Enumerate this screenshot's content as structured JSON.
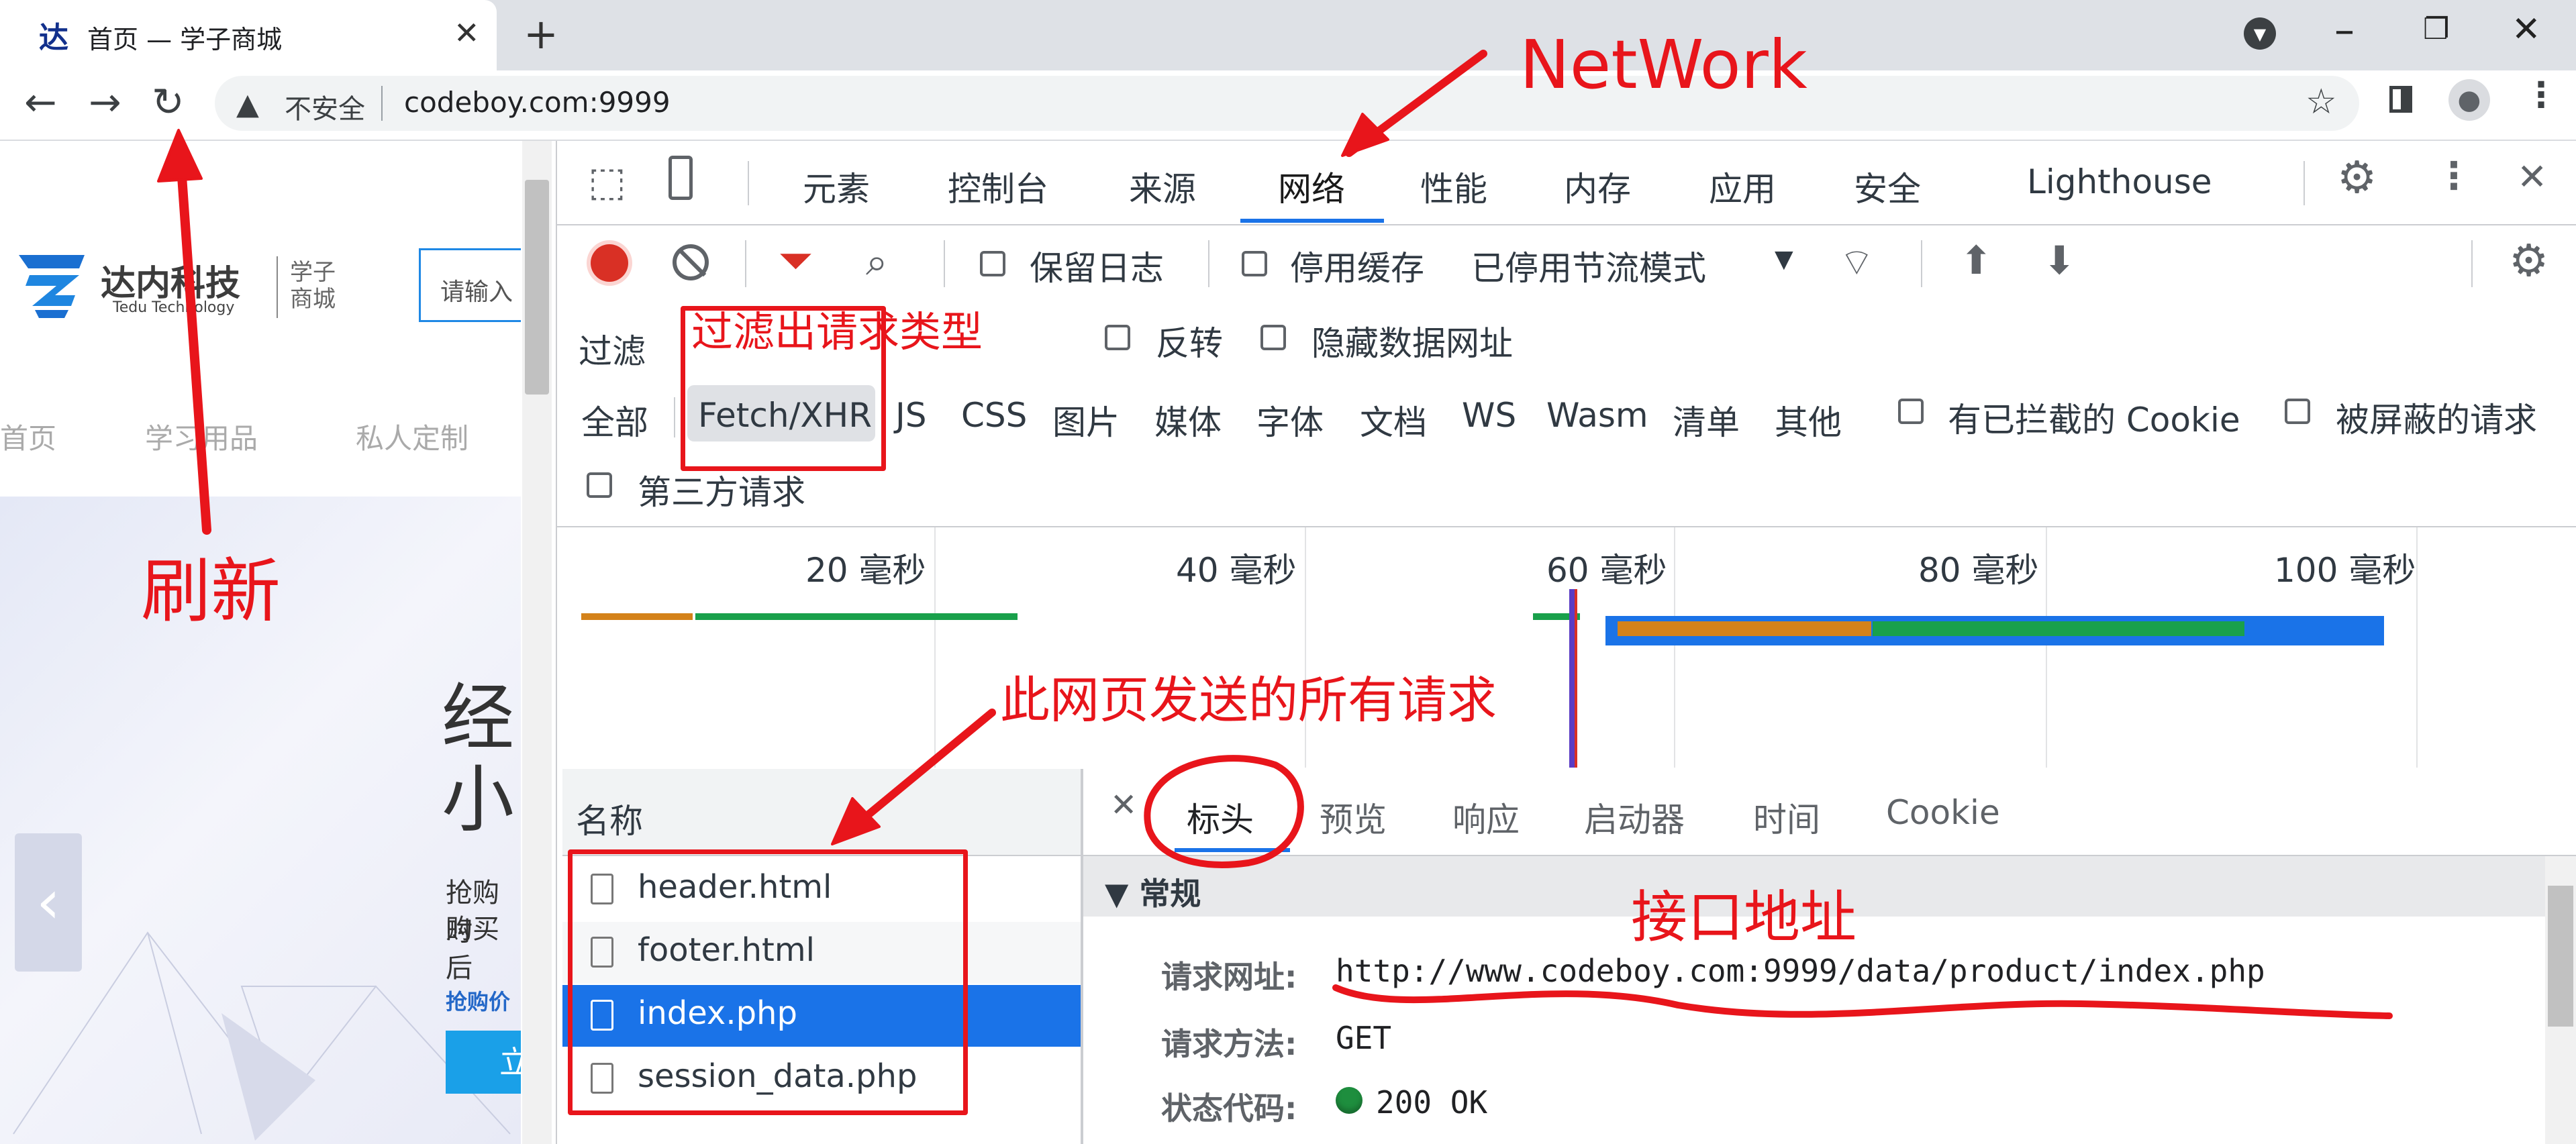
{
  "browser": {
    "tab_title": "首页 — 学子商城",
    "tab_favicon": "达",
    "new_tab": "+",
    "not_secure": "不安全",
    "url": "codeboy.com:9999",
    "icons": [
      "back-icon",
      "forward-icon",
      "reload-icon",
      "warning-icon",
      "star-icon",
      "side-panel-icon",
      "profile-icon",
      "menu-icon"
    ]
  },
  "site": {
    "logo_cn": "达内科技",
    "logo_en": "Tedu Technology",
    "logo_sub": "学子商城",
    "search_placeholder": "请输入",
    "nav": [
      "首页",
      "学习用品",
      "私人定制"
    ],
    "banner_title": "经小",
    "banner_line1": "抢购时",
    "banner_line2": "购买后",
    "banner_price": "抢购价",
    "banner_btn": "立"
  },
  "devtools": {
    "tabs": [
      "元素",
      "控制台",
      "来源",
      "网络",
      "性能",
      "内存",
      "应用",
      "安全",
      "Lighthouse"
    ],
    "active_tab": "网络",
    "toolbar": {
      "preserve_log": "保留日志",
      "disable_cache": "停用缓存",
      "throttling": "已停用节流模式"
    },
    "filter": {
      "placeholder": "过滤",
      "invert": "反转",
      "hide_data_urls": "隐藏数据网址",
      "types": [
        "全部",
        "Fetch/XHR",
        "JS",
        "CSS",
        "图片",
        "媒体",
        "字体",
        "文档",
        "WS",
        "Wasm",
        "清单",
        "其他"
      ],
      "blocked_cookies": "有已拦截的 Cookie",
      "blocked_requests": "被屏蔽的请求",
      "third_party": "第三方请求"
    },
    "timeline_ticks": [
      "20 毫秒",
      "40 毫秒",
      "60 毫秒",
      "80 毫秒",
      "100 毫秒"
    ],
    "requests": {
      "column_name": "名称",
      "items": [
        "header.html",
        "footer.html",
        "index.php",
        "session_data.php"
      ],
      "selected": "index.php"
    },
    "detail": {
      "tabs": [
        "标头",
        "预览",
        "响应",
        "启动器",
        "时间",
        "Cookie"
      ],
      "active_tab": "标头",
      "section": "常规",
      "request_url_key": "请求网址:",
      "request_url": "http://www.codeboy.com:9999/data/product/index.php",
      "method_key": "请求方法:",
      "method": "GET",
      "status_key": "状态代码:",
      "status": "200 OK"
    }
  },
  "annotations": {
    "network": "NetWork",
    "refresh": "刷新",
    "filter_type": "过滤出请求类型",
    "all_requests": "此网页发送的所有请求",
    "api_address": "接口地址"
  },
  "colors": {
    "annotation_red": "#e8151b",
    "accent_blue": "#1a73e8",
    "record_red": "#d93025",
    "status_green": "#1e8e3e"
  }
}
